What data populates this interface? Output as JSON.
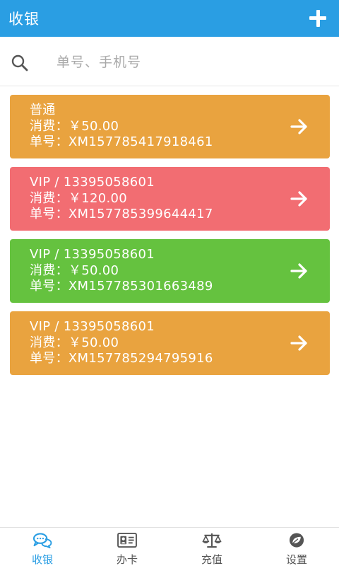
{
  "header": {
    "title": "收银",
    "add_icon": "plus-icon"
  },
  "search": {
    "placeholder": "单号、手机号",
    "value": "",
    "icon": "search-icon"
  },
  "orders": [
    {
      "member": "普通",
      "amount": "消费：￥50.00",
      "order_no": "单号：XM157785417918461",
      "color": "#e9a33f"
    },
    {
      "member": "VIP / 13395058601",
      "amount": "消费：￥120.00",
      "order_no": "单号：XM157785399644417",
      "color": "#f26d72"
    },
    {
      "member": "VIP / 13395058601",
      "amount": "消费：￥50.00",
      "order_no": "单号：XM157785301663489",
      "color": "#65c23f"
    },
    {
      "member": "VIP / 13395058601",
      "amount": "消费：￥50.00",
      "order_no": "单号：XM157785294795916",
      "color": "#e9a33f"
    }
  ],
  "nav": {
    "items": [
      {
        "label": "收银",
        "icon": "chat-bubbles-icon",
        "active": true
      },
      {
        "label": "办卡",
        "icon": "id-card-icon",
        "active": false
      },
      {
        "label": "充值",
        "icon": "scale-icon",
        "active": false
      },
      {
        "label": "设置",
        "icon": "settings-leaf-icon",
        "active": false
      }
    ]
  },
  "colors": {
    "primary": "#2a9ee3",
    "orange": "#e9a33f",
    "red": "#f26d72",
    "green": "#65c23f"
  }
}
